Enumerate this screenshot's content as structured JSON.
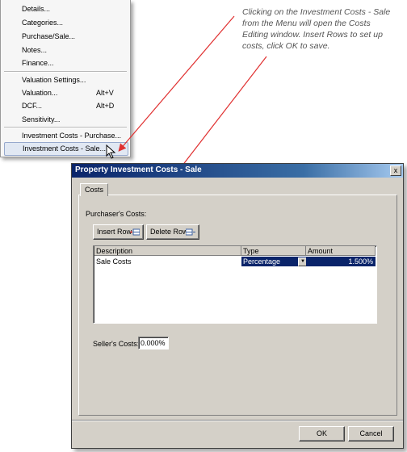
{
  "menu": {
    "items": [
      {
        "label": "Details...",
        "shortcut": ""
      },
      {
        "label": "Categories...",
        "shortcut": ""
      },
      {
        "label": "Purchase/Sale...",
        "shortcut": ""
      },
      {
        "label": "Notes...",
        "shortcut": ""
      },
      {
        "label": "Finance...",
        "shortcut": ""
      },
      {
        "label": "Valuation Settings...",
        "shortcut": ""
      },
      {
        "label": "Valuation...",
        "shortcut": "Alt+V"
      },
      {
        "label": "DCF...",
        "shortcut": "Alt+D"
      },
      {
        "label": "Sensitivity...",
        "shortcut": ""
      },
      {
        "label": "Investment Costs - Purchase...",
        "shortcut": ""
      },
      {
        "label": "Investment Costs - Sale...",
        "shortcut": ""
      }
    ],
    "selected_item": "Investment Costs - Sale..."
  },
  "callout": {
    "text": "Clicking on the Investment Costs - Sale from the Menu will open the Costs Editing window. Insert Rows to set up costs, click OK to save."
  },
  "dialog": {
    "title": "Property Investment Costs - Sale",
    "close_symbol": "x",
    "tab_label": "Costs",
    "purchasers_label": "Purchaser's Costs:",
    "insert_row_label": "Insert Row",
    "delete_row_label": "Delete Row",
    "grid": {
      "columns": [
        "Description",
        "Type",
        "Amount"
      ],
      "rows": [
        {
          "description": "Sale Costs",
          "type": "Percentage",
          "amount": "1.500%"
        }
      ]
    },
    "sellers_label": "Seller's Costs:",
    "sellers_value": "0.000%",
    "ok_label": "OK",
    "cancel_label": "Cancel"
  },
  "colors": {
    "titlebar": "#0a246a",
    "dialog_face": "#d4d0c8",
    "arrow": "#e03030",
    "selection": "#0a246a"
  }
}
